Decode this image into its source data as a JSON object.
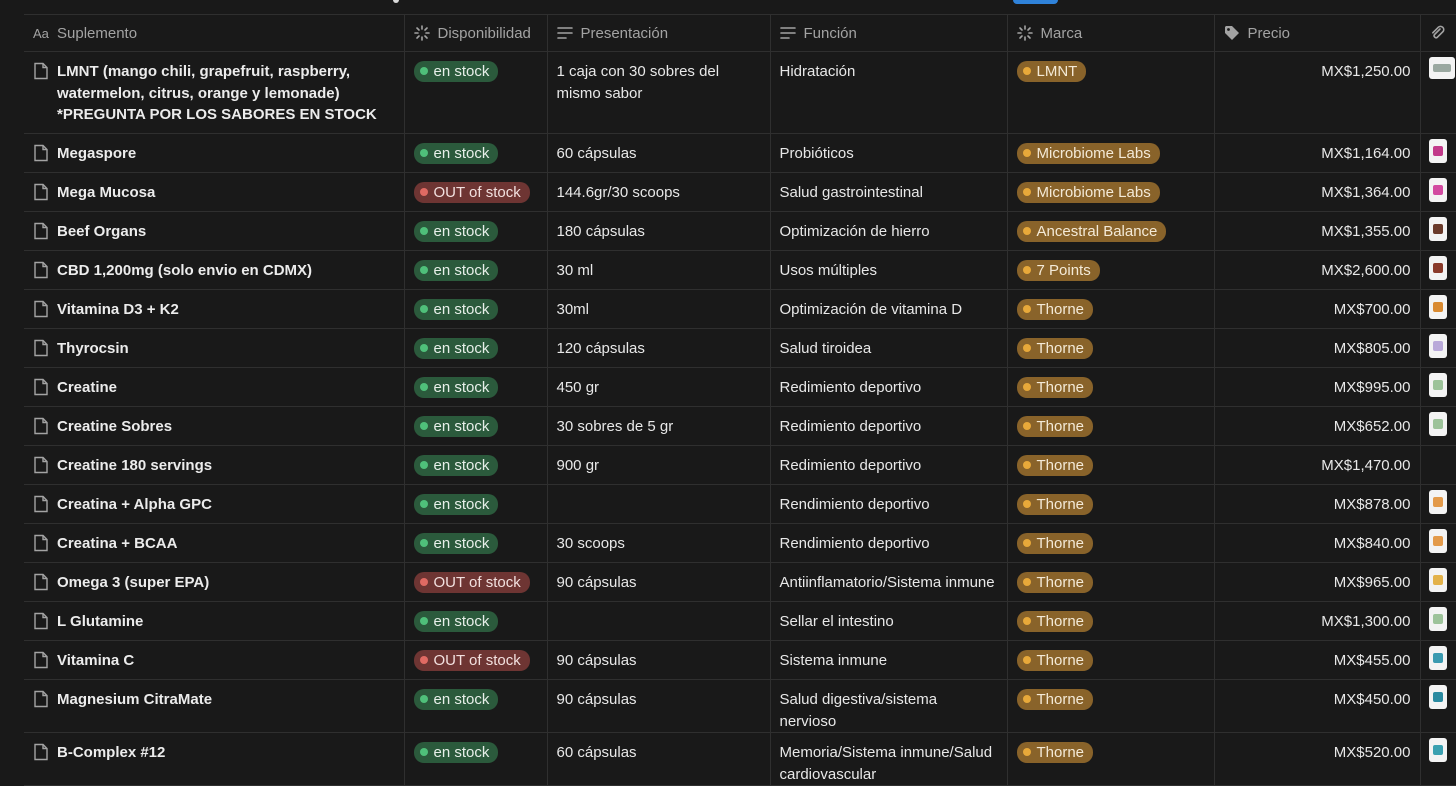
{
  "columns": {
    "name": "Suplemento",
    "availability": "Disponibilidad",
    "presentation": "Presentación",
    "function": "Función",
    "brand": "Marca",
    "price": "Precio"
  },
  "colors": {
    "in_stock": "#2b5a3c",
    "out_of_stock": "#6e3533",
    "brand_tag": "#89632a",
    "background": "#191919"
  },
  "icons": {
    "name_column": "text-aa-icon",
    "availability_column": "status-loader-icon",
    "presentation_column": "text-lines-icon",
    "function_column": "text-lines-icon",
    "brand_column": "status-loader-icon",
    "price_column": "price-tag-icon",
    "link_column": "paperclip-icon",
    "row": "page-icon"
  },
  "rows": [
    {
      "name": "LMNT (mango chili, grapefruit, raspberry, watermelon, citrus, orange y lemonade) *PREGUNTA POR LOS SABORES EN STOCK",
      "status": "en stock",
      "presentation": "1 caja con 30 sobres del mismo sabor",
      "function": "Hidratación",
      "brand": "LMNT",
      "price": "MX$1,250.00"
    },
    {
      "name": "Megaspore",
      "status": "en stock",
      "presentation": "60 cápsulas",
      "function": "Probióticos",
      "brand": "Microbiome Labs",
      "price": "MX$1,164.00"
    },
    {
      "name": "Mega Mucosa",
      "status": "OUT of stock",
      "presentation": "144.6gr/30 scoops",
      "function": "Salud gastrointestinal",
      "brand": "Microbiome Labs",
      "price": "MX$1,364.00"
    },
    {
      "name": "Beef Organs",
      "status": "en stock",
      "presentation": "180 cápsulas",
      "function": "Optimización de hierro",
      "brand": "Ancestral Balance",
      "price": "MX$1,355.00"
    },
    {
      "name": "CBD 1,200mg (solo envio en CDMX)",
      "status": "en stock",
      "presentation": "30 ml",
      "function": "Usos múltiples",
      "brand": "7 Points",
      "price": "MX$2,600.00"
    },
    {
      "name": "Vitamina D3 + K2",
      "status": "en stock",
      "presentation": "30ml",
      "function": "Optimización de vitamina D",
      "brand": "Thorne",
      "price": "MX$700.00"
    },
    {
      "name": "Thyrocsin",
      "status": "en stock",
      "presentation": "120 cápsulas",
      "function": "Salud tiroidea",
      "brand": "Thorne",
      "price": "MX$805.00"
    },
    {
      "name": "Creatine",
      "status": "en stock",
      "presentation": "450 gr",
      "function": "Redimiento deportivo",
      "brand": "Thorne",
      "price": "MX$995.00"
    },
    {
      "name": "Creatine Sobres",
      "status": "en stock",
      "presentation": "30 sobres de 5 gr",
      "function": "Redimiento deportivo",
      "brand": "Thorne",
      "price": "MX$652.00"
    },
    {
      "name": "Creatine 180 servings",
      "status": "en stock",
      "presentation": "900 gr",
      "function": "Redimiento deportivo",
      "brand": "Thorne",
      "price": "MX$1,470.00"
    },
    {
      "name": "Creatina + Alpha GPC",
      "status": "en stock",
      "presentation": "",
      "function": "Rendimiento deportivo",
      "brand": "Thorne",
      "price": "MX$878.00"
    },
    {
      "name": "Creatina + BCAA",
      "status": "en stock",
      "presentation": "30 scoops",
      "function": "Rendimiento deportivo",
      "brand": "Thorne",
      "price": "MX$840.00"
    },
    {
      "name": "Omega 3 (super EPA)",
      "status": "OUT of stock",
      "presentation": "90 cápsulas",
      "function": "Antiinflamatorio/Sistema inmune",
      "brand": "Thorne",
      "price": "MX$965.00"
    },
    {
      "name": "L Glutamine",
      "status": "en stock",
      "presentation": "",
      "function": "Sellar el intestino",
      "brand": "Thorne",
      "price": "MX$1,300.00"
    },
    {
      "name": "Vitamina C",
      "status": "OUT of stock",
      "presentation": "90 cápsulas",
      "function": "Sistema inmune",
      "brand": "Thorne",
      "price": "MX$455.00"
    },
    {
      "name": "Magnesium CitraMate",
      "status": "en stock",
      "presentation": "90 cápsulas",
      "function": "Salud digestiva/sistema nervioso",
      "brand": "Thorne",
      "price": "MX$450.00"
    },
    {
      "name": "B-Complex #12",
      "status": "en stock",
      "presentation": "60 cápsulas",
      "function": "Memoria/Sistema inmune/Salud cardiovascular",
      "brand": "Thorne",
      "price": "MX$520.00"
    }
  ]
}
